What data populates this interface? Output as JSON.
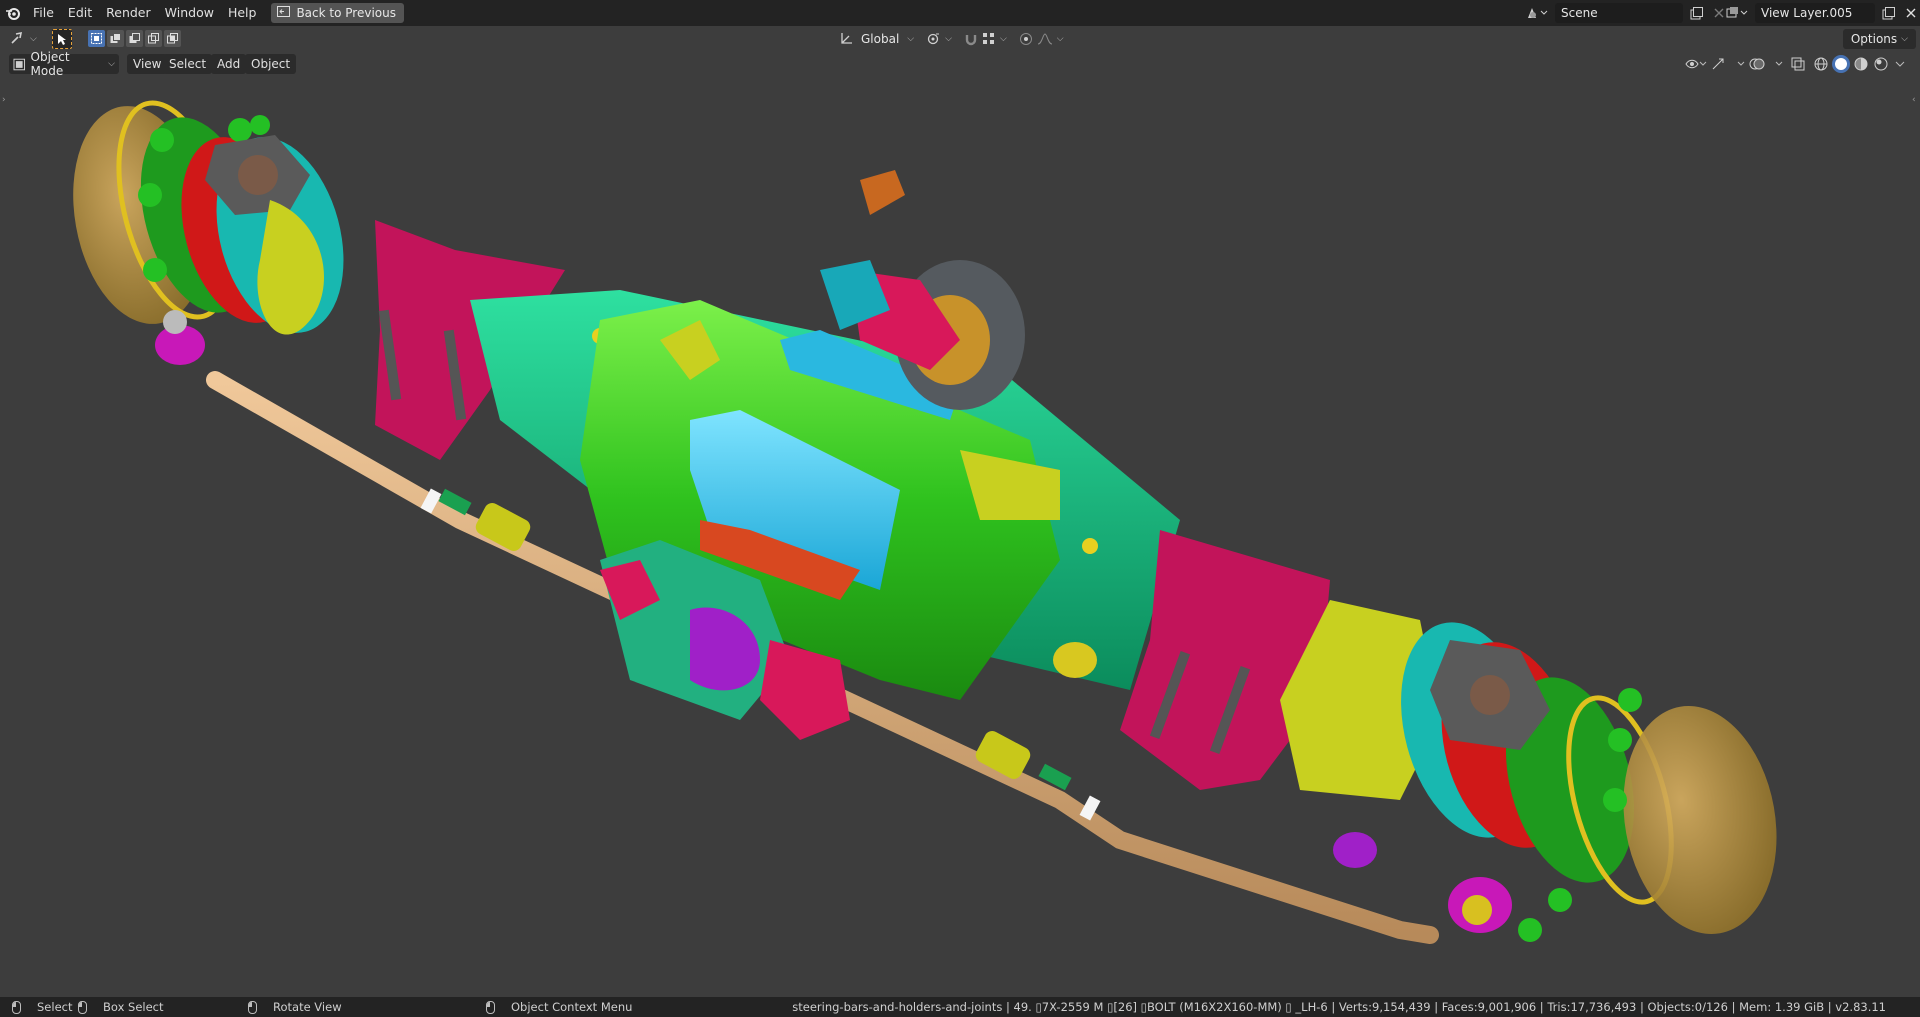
{
  "menubar": {
    "items": [
      "File",
      "Edit",
      "Render",
      "Window",
      "Help"
    ],
    "back_button": "Back to Previous",
    "scene": "Scene",
    "view_layer": "View Layer.005"
  },
  "tool_header": {
    "transform_orientation": "Global",
    "options_label": "Options"
  },
  "viewport_header": {
    "mode": "Object Mode",
    "menus": [
      "View",
      "Select",
      "Add",
      "Object"
    ]
  },
  "statusbar": {
    "hints": [
      {
        "label": "Select"
      },
      {
        "label": "Box Select"
      },
      {
        "label": "Rotate View"
      },
      {
        "label": "Object Context Menu"
      }
    ],
    "stats": "steering-bars-and-holders-and-joints | 49. ▯7X-2559 M ▯[26] ▯BOLT (M16X2X160-MM) ▯ _LH-6 | Verts:9,154,439 | Faces:9,001,906 | Tris:17,736,493 | Objects:0/126 | Mem: 1.39 GiB | v2.83.11"
  },
  "colors": {
    "header_bg": "#232323",
    "viewport_bg": "#3d3d3d",
    "accent_blue": "#4772b3",
    "tool_active_outline": "#e6a23a"
  }
}
